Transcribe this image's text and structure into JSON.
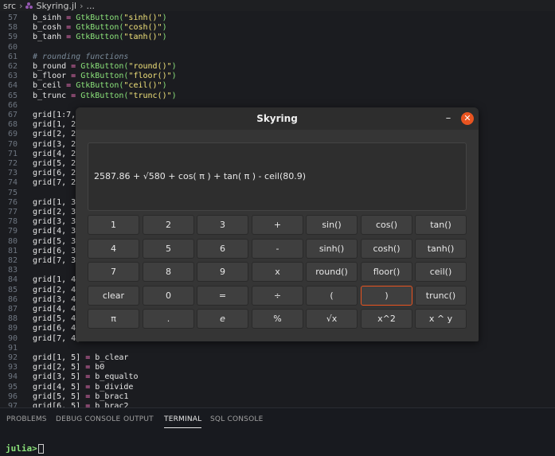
{
  "breadcrumb": {
    "folder": "src",
    "file": "Skyring.jl",
    "more": "..."
  },
  "code_lines": [
    {
      "n": "57",
      "parts": [
        [
          "b_sinh",
          "v"
        ],
        [
          " = ",
          "op"
        ],
        [
          "GtkButton(",
          "fn"
        ],
        [
          "\"sinh()\"",
          "str"
        ],
        [
          ")",
          "fn"
        ]
      ]
    },
    {
      "n": "58",
      "parts": [
        [
          "b_cosh",
          "v"
        ],
        [
          " = ",
          "op"
        ],
        [
          "GtkButton(",
          "fn"
        ],
        [
          "\"cosh()\"",
          "str"
        ],
        [
          ")",
          "fn"
        ]
      ]
    },
    {
      "n": "59",
      "parts": [
        [
          "b_tanh",
          "v"
        ],
        [
          " = ",
          "op"
        ],
        [
          "GtkButton(",
          "fn"
        ],
        [
          "\"tanh()\"",
          "str"
        ],
        [
          ")",
          "fn"
        ]
      ]
    },
    {
      "n": "60",
      "parts": []
    },
    {
      "n": "61",
      "parts": [
        [
          "# rounding functions",
          "cm"
        ]
      ]
    },
    {
      "n": "62",
      "parts": [
        [
          "b_round",
          "v"
        ],
        [
          " = ",
          "op"
        ],
        [
          "GtkButton(",
          "fn"
        ],
        [
          "\"round()\"",
          "str"
        ],
        [
          ")",
          "fn"
        ]
      ]
    },
    {
      "n": "63",
      "parts": [
        [
          "b_floor",
          "v"
        ],
        [
          " = ",
          "op"
        ],
        [
          "GtkButton(",
          "fn"
        ],
        [
          "\"floor()\"",
          "str"
        ],
        [
          ")",
          "fn"
        ]
      ]
    },
    {
      "n": "64",
      "parts": [
        [
          "b_ceil",
          "v"
        ],
        [
          " = ",
          "op"
        ],
        [
          "GtkButton(",
          "fn"
        ],
        [
          "\"ceil()\"",
          "str"
        ],
        [
          ")",
          "fn"
        ]
      ]
    },
    {
      "n": "65",
      "parts": [
        [
          "b_trunc",
          "v"
        ],
        [
          " = ",
          "op"
        ],
        [
          "GtkButton(",
          "fn"
        ],
        [
          "\"trunc()\"",
          "str"
        ],
        [
          ")",
          "fn"
        ]
      ]
    },
    {
      "n": "66",
      "parts": []
    },
    {
      "n": "67",
      "parts": [
        [
          "grid[1:7,",
          "v"
        ]
      ]
    },
    {
      "n": "68",
      "parts": [
        [
          "grid[1, 2]",
          "v"
        ]
      ]
    },
    {
      "n": "69",
      "parts": [
        [
          "grid[2, 2]",
          "v"
        ]
      ]
    },
    {
      "n": "70",
      "parts": [
        [
          "grid[3, 2]",
          "v"
        ]
      ]
    },
    {
      "n": "71",
      "parts": [
        [
          "grid[4, 2]",
          "v"
        ]
      ]
    },
    {
      "n": "72",
      "parts": [
        [
          "grid[5, 2]",
          "v"
        ]
      ]
    },
    {
      "n": "73",
      "parts": [
        [
          "grid[6, 2]",
          "v"
        ]
      ]
    },
    {
      "n": "74",
      "parts": [
        [
          "grid[7, 2]",
          "v"
        ]
      ]
    },
    {
      "n": "75",
      "parts": []
    },
    {
      "n": "76",
      "parts": [
        [
          "grid[1, 3]",
          "v"
        ]
      ]
    },
    {
      "n": "77",
      "parts": [
        [
          "grid[2, 3]",
          "v"
        ]
      ]
    },
    {
      "n": "78",
      "parts": [
        [
          "grid[3, 3]",
          "v"
        ]
      ]
    },
    {
      "n": "79",
      "parts": [
        [
          "grid[4, 3]",
          "v"
        ]
      ]
    },
    {
      "n": "80",
      "parts": [
        [
          "grid[5, 3]",
          "v"
        ]
      ]
    },
    {
      "n": "81",
      "parts": [
        [
          "grid[6, 3]",
          "v"
        ]
      ]
    },
    {
      "n": "82",
      "parts": [
        [
          "grid[7, 3]",
          "v"
        ]
      ]
    },
    {
      "n": "83",
      "parts": []
    },
    {
      "n": "84",
      "parts": [
        [
          "grid[1, 4]",
          "v"
        ]
      ]
    },
    {
      "n": "85",
      "parts": [
        [
          "grid[2, 4]",
          "v"
        ]
      ]
    },
    {
      "n": "86",
      "parts": [
        [
          "grid[3, 4]",
          "v"
        ]
      ]
    },
    {
      "n": "87",
      "parts": [
        [
          "grid[4, 4]",
          "v"
        ]
      ]
    },
    {
      "n": "88",
      "parts": [
        [
          "grid[5, 4]",
          "v"
        ]
      ]
    },
    {
      "n": "89",
      "parts": [
        [
          "grid[6, 4]",
          "v"
        ]
      ]
    },
    {
      "n": "90",
      "parts": [
        [
          "grid[7, 4]",
          "v"
        ]
      ]
    },
    {
      "n": "91",
      "parts": []
    },
    {
      "n": "92",
      "parts": [
        [
          "grid[1, 5]",
          "v"
        ],
        [
          " = ",
          "op"
        ],
        [
          "b_clear",
          "v"
        ]
      ]
    },
    {
      "n": "93",
      "parts": [
        [
          "grid[2, 5]",
          "v"
        ],
        [
          " = ",
          "op"
        ],
        [
          "b0",
          "v"
        ]
      ]
    },
    {
      "n": "94",
      "parts": [
        [
          "grid[3, 5]",
          "v"
        ],
        [
          " = ",
          "op"
        ],
        [
          "b_equalto",
          "v"
        ]
      ]
    },
    {
      "n": "95",
      "parts": [
        [
          "grid[4, 5]",
          "v"
        ],
        [
          " = ",
          "op"
        ],
        [
          "b_divide",
          "v"
        ]
      ]
    },
    {
      "n": "96",
      "parts": [
        [
          "grid[5, 5]",
          "v"
        ],
        [
          " = ",
          "op"
        ],
        [
          "b_brac1",
          "v"
        ]
      ]
    },
    {
      "n": "97",
      "parts": [
        [
          "grid[6, 5]",
          "v"
        ],
        [
          " = ",
          "op"
        ],
        [
          "b_brac2",
          "v"
        ]
      ]
    }
  ],
  "dialog": {
    "title": "Skyring",
    "minimize_label": "–",
    "close_label": "✕",
    "display_text": "2587.86 + √580 + cos( π ) + tan( π ) - ceil(80.9)",
    "rows": [
      [
        "1",
        "2",
        "3",
        "+",
        "sin()",
        "cos()",
        "tan()"
      ],
      [
        "4",
        "5",
        "6",
        "-",
        "sinh()",
        "cosh()",
        "tanh()"
      ],
      [
        "7",
        "8",
        "9",
        "x",
        "round()",
        "floor()",
        "ceil()"
      ],
      [
        "clear",
        "0",
        "=",
        "÷",
        "(",
        ")",
        "trunc()"
      ],
      [
        "π",
        ".",
        "e",
        "%",
        "√x",
        "x^2",
        "x ^ y"
      ]
    ],
    "focused_button": ")"
  },
  "panel": {
    "tabs": [
      "PROBLEMS",
      "DEBUG CONSOLE",
      "OUTPUT",
      "TERMINAL",
      "SQL CONSOLE"
    ],
    "active_tab": "TERMINAL",
    "prompt": "julia>"
  },
  "colors": {
    "accent": "#e95420",
    "julia_prompt": "#8be27a"
  }
}
